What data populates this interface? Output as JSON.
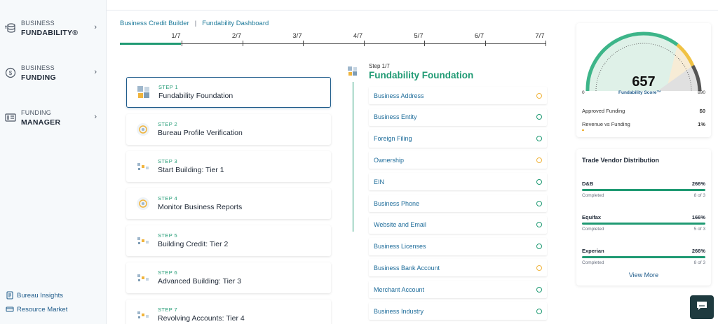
{
  "sidebar": {
    "items": [
      {
        "top": "BUSINESS",
        "bottom": "FUNDABILITY®"
      },
      {
        "top": "BUSINESS",
        "bottom": "FUNDING"
      },
      {
        "top": "FUNDING",
        "bottom": "MANAGER"
      }
    ],
    "links": [
      {
        "label": "Bureau Insights"
      },
      {
        "label": "Resource Market"
      }
    ]
  },
  "breadcrumb": {
    "first": "Business Credit Builder",
    "separator": "|",
    "second": "Fundability Dashboard"
  },
  "progress": {
    "labels": [
      "1/7",
      "2/7",
      "3/7",
      "4/7",
      "5/7",
      "6/7",
      "7/7"
    ],
    "completed_fraction": 0.143
  },
  "steps": [
    {
      "step": "STEP 1",
      "title": "Fundability Foundation"
    },
    {
      "step": "STEP 2",
      "title": "Bureau Profile Verification"
    },
    {
      "step": "STEP 3",
      "title": "Start Building: Tier 1"
    },
    {
      "step": "STEP 4",
      "title": "Monitor Business Reports"
    },
    {
      "step": "STEP 5",
      "title": "Building Credit: Tier 2"
    },
    {
      "step": "STEP 6",
      "title": "Advanced Building: Tier 3"
    },
    {
      "step": "STEP 7",
      "title": "Revolving Accounts: Tier 4"
    }
  ],
  "detail": {
    "step": "Step 1/7",
    "title": "Fundability Foundation",
    "items": [
      {
        "label": "Business Address",
        "status": "pending"
      },
      {
        "label": "Business Entity",
        "status": "ok"
      },
      {
        "label": "Foreign Filing",
        "status": "ok"
      },
      {
        "label": "Ownership",
        "status": "pending"
      },
      {
        "label": "EIN",
        "status": "ok"
      },
      {
        "label": "Business Phone",
        "status": "ok"
      },
      {
        "label": "Website and Email",
        "status": "ok"
      },
      {
        "label": "Business Licenses",
        "status": "ok"
      },
      {
        "label": "Business Bank Account",
        "status": "pending"
      },
      {
        "label": "Merchant Account",
        "status": "ok"
      },
      {
        "label": "Business Industry",
        "status": "ok"
      }
    ]
  },
  "score": {
    "value": "657",
    "label": "Fundability Score™",
    "min": "0",
    "max": "890",
    "approved_label": "Approved Funding",
    "approved_value": "$0",
    "revenue_label": "Revenue vs Funding",
    "revenue_value": "1%"
  },
  "vendors": {
    "title": "Trade Vendor Distribution",
    "list": [
      {
        "name": "D&B",
        "percent": "266%",
        "status": "Completed",
        "count": "8 of 3"
      },
      {
        "name": "Equifax",
        "percent": "166%",
        "status": "Completed",
        "count": "5 of 3"
      },
      {
        "name": "Experian",
        "percent": "266%",
        "status": "Completed",
        "count": "8 of 3"
      }
    ],
    "view_more": "View More"
  },
  "colors": {
    "accent": "#1f9a73",
    "link": "#1e5b8a",
    "pending": "#f0b43c"
  }
}
